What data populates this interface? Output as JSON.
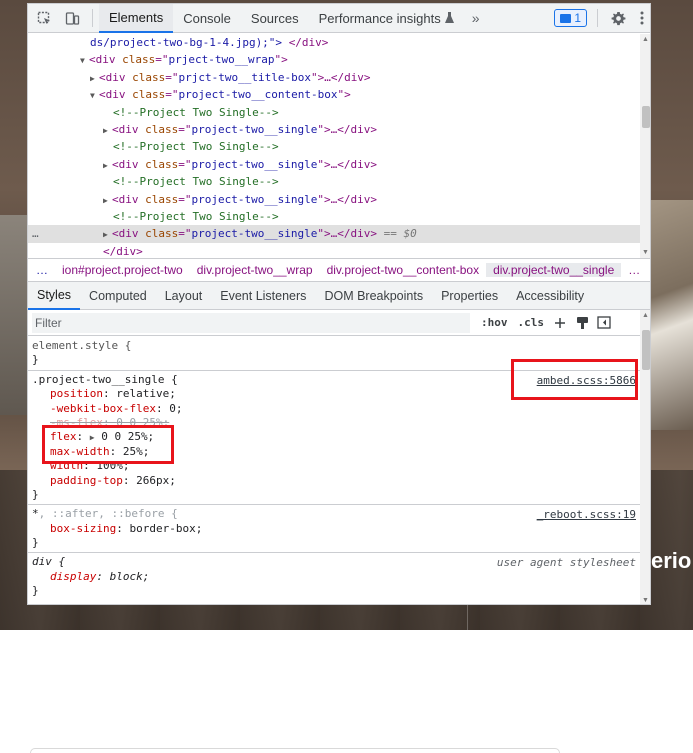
{
  "background": {
    "heading_fragment": "erio"
  },
  "toolbar": {
    "tabs": [
      "Elements",
      "Console",
      "Sources",
      "Performance insights"
    ],
    "more": "»",
    "messages_count": "1"
  },
  "tree": {
    "line0_val": "ds/project-two-bg-1-4.jpg);\">",
    "line0_close": "</div>",
    "line1": {
      "open": "<div ",
      "attr": "class",
      "eq": "=\"",
      "val": "prject-two__wrap",
      "close": "\">"
    },
    "line2": {
      "open": "<div ",
      "attr": "class",
      "eq": "=\"",
      "val": "prjct-two__title-box",
      "close": "\">…</div>"
    },
    "line3": {
      "open": "<div ",
      "attr": "class",
      "eq": "=\"",
      "val": "project-two__content-box",
      "close": "\">"
    },
    "comment": "<!--Project Two Single-->",
    "single": {
      "open": "<div ",
      "attr": "class",
      "eq": "=\"",
      "val": "project-two__single",
      "close": "\">…</div>"
    },
    "selected_suffix": " == $0",
    "close_div": "</div>",
    "ellipsis": "…"
  },
  "breadcrumbs": [
    "…",
    "ion#project.project-two",
    "div.project-two__wrap",
    "div.project-two__content-box",
    "div.project-two__single",
    "…"
  ],
  "styles_tabs": [
    "Styles",
    "Computed",
    "Layout",
    "Event Listeners",
    "DOM Breakpoints",
    "Properties",
    "Accessibility"
  ],
  "filter": {
    "placeholder": "Filter",
    "hov": ":hov",
    "cls": ".cls"
  },
  "rules": {
    "element_style": "element.style {",
    "close": "}",
    "r1": {
      "selector": ".project-two__single {",
      "source": "ambed.scss:5866",
      "p1": {
        "name": "position",
        "value": "relative;"
      },
      "p2": {
        "name": "-webkit-box-flex",
        "value": "0;"
      },
      "p3": {
        "name": "-ms-flex",
        "value": "0 0 25%;"
      },
      "p4": {
        "name": "flex",
        "value": "0 0 25%;"
      },
      "p5": {
        "name": "max-width",
        "value": "25%;"
      },
      "p6": {
        "name": "width",
        "value": "100%;"
      },
      "p7": {
        "name": "padding-top",
        "value": "266px;"
      }
    },
    "r2": {
      "selector_main": "*",
      "selector_rest": ", ::after, ::before {",
      "source": "_reboot.scss:19",
      "p1": {
        "name": "box-sizing",
        "value": "border-box;"
      }
    },
    "r3": {
      "selector": "div {",
      "source": "user agent stylesheet",
      "p1": {
        "name": "display",
        "value": "block;"
      }
    }
  },
  "colors": {
    "annotation": "#e8141b",
    "accent": "#1a73e8"
  }
}
